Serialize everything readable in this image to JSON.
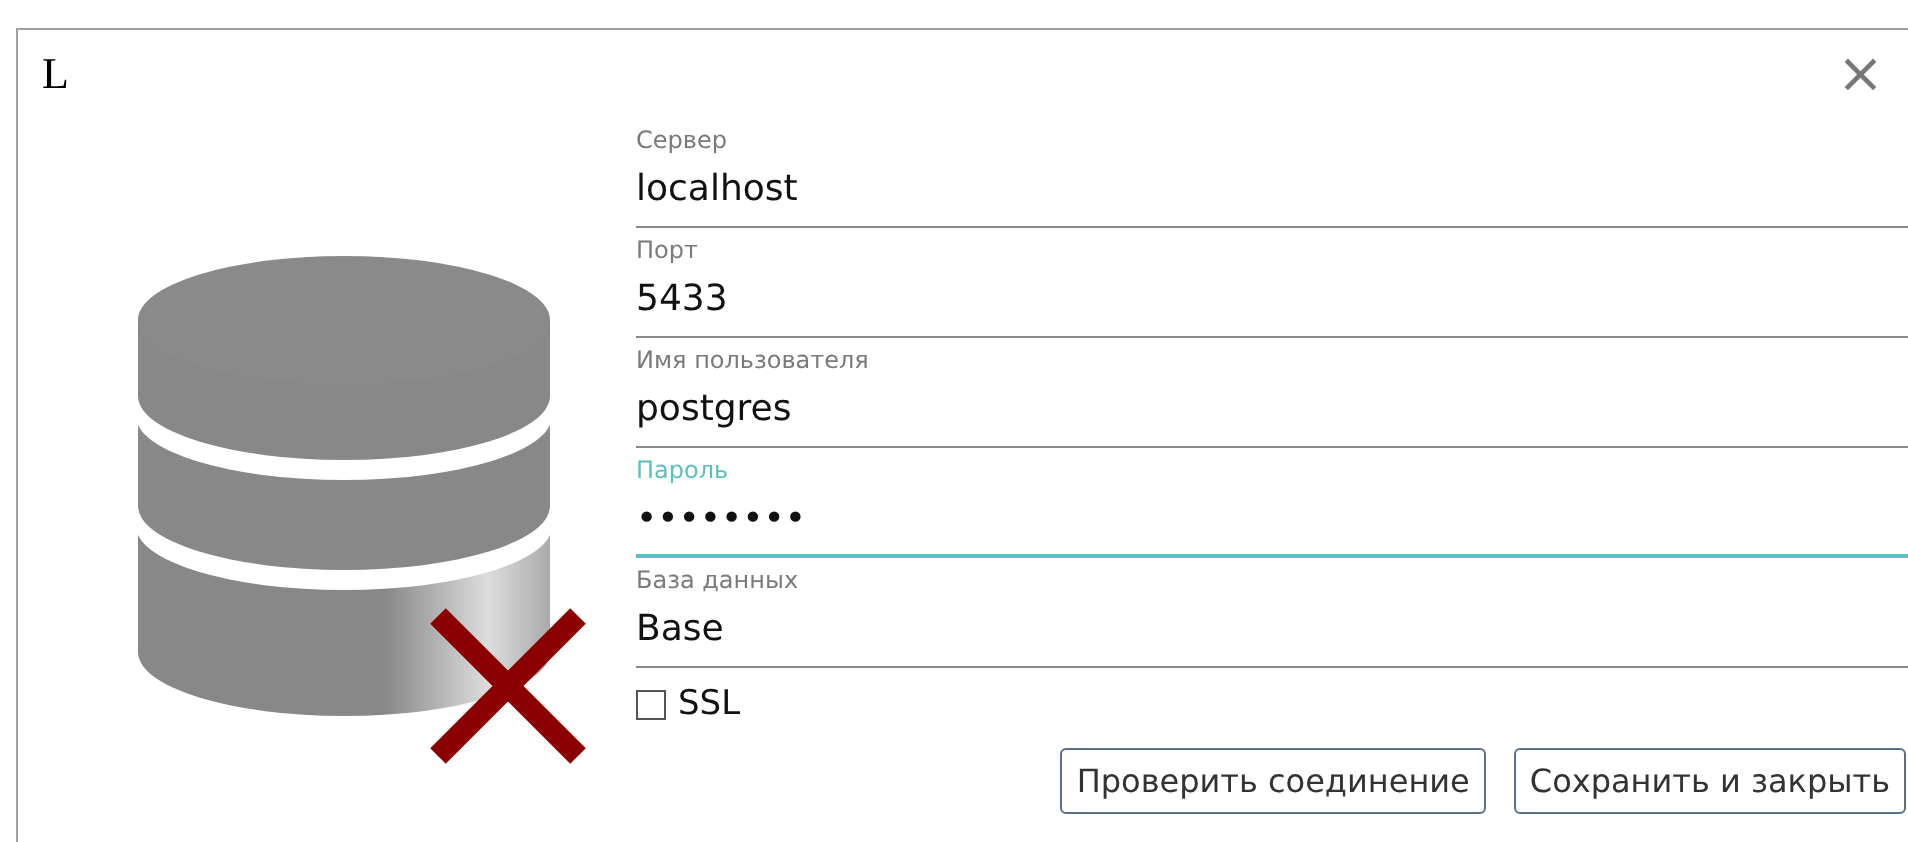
{
  "window": {
    "title": "L",
    "close": "×"
  },
  "fields": [
    {
      "label": "Сервер",
      "value": "localhost",
      "focused": false
    },
    {
      "label": "Порт",
      "value": "5433",
      "focused": false
    },
    {
      "label": "Имя пользователя",
      "value": "postgres",
      "focused": false
    },
    {
      "label": "Пароль",
      "value": "••••••••",
      "focused": true
    },
    {
      "label": "База данных",
      "value": "Base",
      "focused": false
    }
  ],
  "ssl": {
    "label": "SSL",
    "checked": false
  },
  "buttons": [
    "Проверить соединение",
    "Сохранить и закрыть"
  ]
}
